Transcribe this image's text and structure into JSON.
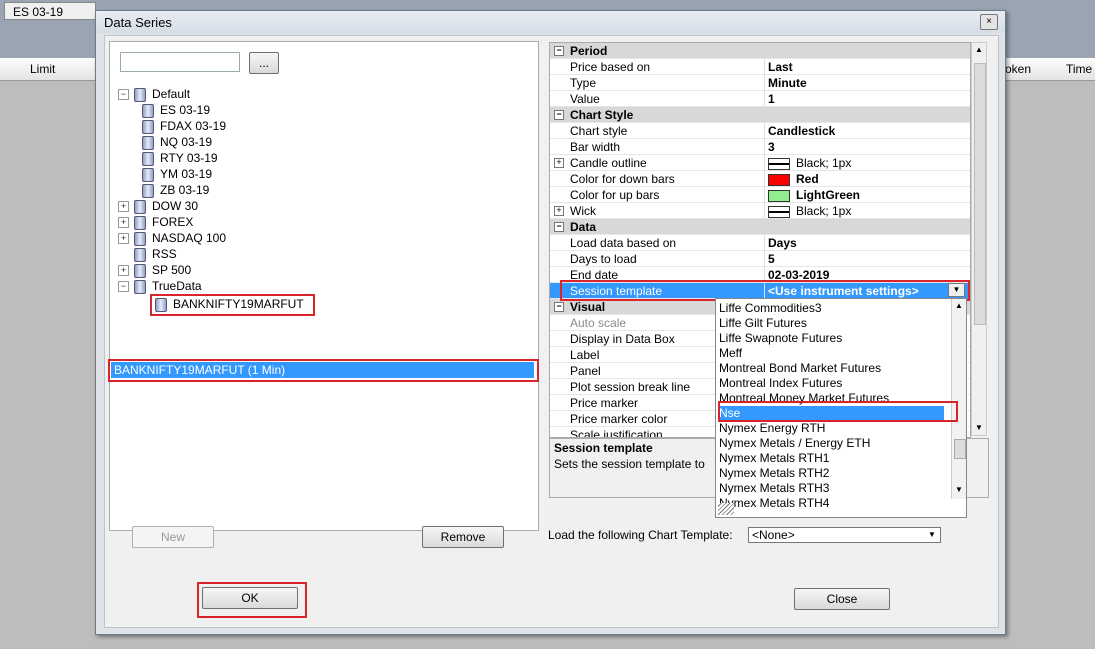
{
  "background": {
    "tab_label": "ES 03-19",
    "col_limit": "Limit",
    "col_token": "oken",
    "col_time": "Time"
  },
  "dialog": {
    "title": "Data Series",
    "close_glyph": "×",
    "dots_label": "...",
    "tree": {
      "default": "Default",
      "default_children": [
        "ES 03-19",
        "FDAX 03-19",
        "NQ 03-19",
        "RTY 03-19",
        "YM 03-19",
        "ZB 03-19"
      ],
      "dow": "DOW 30",
      "forex": "FOREX",
      "nasdaq": "NASDAQ 100",
      "rss": "RSS",
      "sp": "SP 500",
      "truedata": "TrueData",
      "truedata_child": "BANKNIFTY19MARFUT"
    },
    "selected_series": "BANKNIFTY19MARFUT (1 Min)",
    "new_label": "New",
    "remove_label": "Remove",
    "ok_label": "OK",
    "close_label": "Close",
    "props": {
      "period_cat": "Period",
      "price_based_on": "Price based on",
      "price_based_on_val": "Last",
      "type": "Type",
      "type_val": "Minute",
      "value": "Value",
      "value_val": "1",
      "chartstyle_cat": "Chart Style",
      "chart_style": "Chart style",
      "chart_style_val": "Candlestick",
      "bar_width": "Bar width",
      "bar_width_val": "3",
      "candle_outline": "Candle outline",
      "candle_outline_val": "Black; 1px",
      "down_bars": "Color for down bars",
      "down_bars_val": "Red",
      "down_color": "#ff0000",
      "up_bars": "Color for up bars",
      "up_bars_val": "LightGreen",
      "up_color": "#90ee90",
      "wick": "Wick",
      "wick_val": "Black; 1px",
      "data_cat": "Data",
      "load_based_on": "Load data based on",
      "load_based_on_val": "Days",
      "days_to_load": "Days to load",
      "days_to_load_val": "5",
      "end_date": "End date",
      "end_date_val": "02-03-2019",
      "session_template": "Session template",
      "session_template_val": "<Use instrument settings>",
      "visual_cat": "Visual",
      "auto_scale": "Auto scale",
      "display_data_box": "Display in Data Box",
      "label": "Label",
      "panel": "Panel",
      "plot_session": "Plot session break line",
      "price_marker": "Price marker",
      "price_marker_color": "Price marker color",
      "scale_just": "Scale justification"
    },
    "description": {
      "title": "Session template",
      "text": "Sets the session template to"
    },
    "dropdown_items": [
      "Liffe Commodities3",
      "Liffe Gilt Futures",
      "Liffe Swapnote Futures",
      "Meff",
      "Montreal Bond Market Futures",
      "Montreal Index Futures",
      "Montreal Money Market Futures",
      "Nse",
      "Nymex Energy RTH",
      "Nymex Metals / Energy ETH",
      "Nymex Metals RTH1",
      "Nymex Metals RTH2",
      "Nymex Metals RTH3",
      "Nymex Metals RTH4"
    ],
    "chart_template_label": "Load the following Chart Template:",
    "chart_template_val": "<None>"
  }
}
